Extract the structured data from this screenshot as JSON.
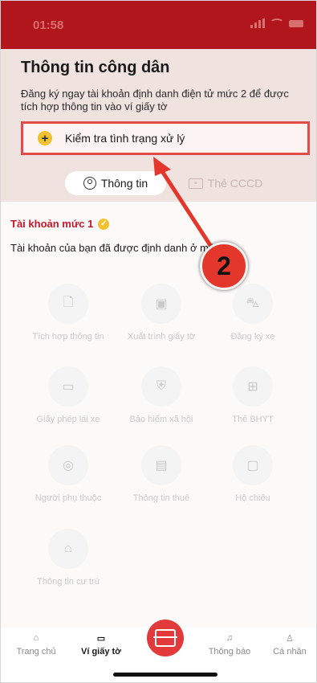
{
  "status_bar": {
    "time": "01:58"
  },
  "header": {
    "title": "Thông tin công dân",
    "subtitle": "Đăng ký ngay tài khoản định danh điện tử mức 2 để được tích hợp thông tin vào ví giấy tờ"
  },
  "check_status": {
    "label": "Kiểm tra tình trạng xử lý",
    "icon": "plus-circle-icon"
  },
  "segments": [
    {
      "label": "Thông tin",
      "icon": "user-circle-icon"
    },
    {
      "label": "Thẻ CCCD",
      "icon": "id-card-icon"
    }
  ],
  "account": {
    "title": "Tài khoản mức 1",
    "description": "Tài khoản của bạn đã được định danh ở mức 1"
  },
  "grid": [
    {
      "label": "Tích hợp thông tin",
      "icon": "file-add-icon"
    },
    {
      "label": "Xuất trình giấy tờ",
      "icon": "qr-card-icon"
    },
    {
      "label": "Đăng ký xe",
      "icon": "car-icon"
    },
    {
      "label": "Giấy phép lái xe",
      "icon": "license-icon"
    },
    {
      "label": "Bảo hiểm xã hội",
      "icon": "shield-plus-icon"
    },
    {
      "label": "Thẻ BHYT",
      "icon": "health-card-icon"
    },
    {
      "label": "Người phụ thuộc",
      "icon": "dependent-icon"
    },
    {
      "label": "Thông tin thuế",
      "icon": "vnd-icon"
    },
    {
      "label": "Hộ chiếu",
      "icon": "passport-icon"
    },
    {
      "label": "Thông tin cư trú",
      "icon": "house-user-icon"
    }
  ],
  "tabbar": [
    {
      "label": "Trang chủ",
      "icon": "home-icon"
    },
    {
      "label": "Ví giấy tờ",
      "icon": "wallet-icon"
    },
    {
      "label": "Thông báo",
      "icon": "bell-icon"
    },
    {
      "label": "Cá nhân",
      "icon": "person-icon"
    }
  ],
  "annotation": {
    "number": "2"
  },
  "colors": {
    "brand_red": "#b2161d",
    "accent_red": "#e04b4b",
    "badge_yellow": "#f2c12e"
  }
}
